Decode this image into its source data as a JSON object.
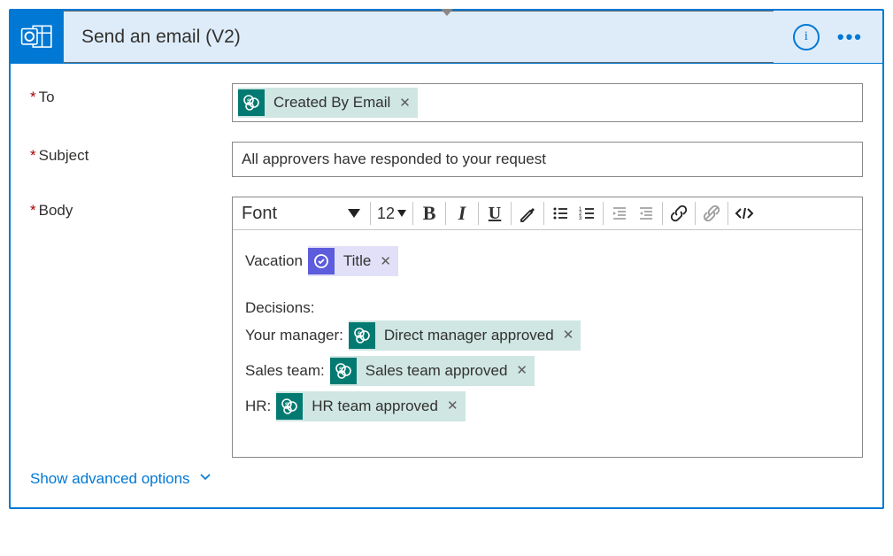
{
  "header": {
    "title": "Send an email (V2)",
    "info_label": "i",
    "menu_label": "•••"
  },
  "fields": {
    "to": {
      "label": "To",
      "required": true,
      "token": "Created By Email"
    },
    "subject": {
      "label": "Subject",
      "required": true,
      "value": "All approvers have responded to your request"
    },
    "body": {
      "label": "Body",
      "required": true
    }
  },
  "toolbar": {
    "font": "Font",
    "size": "12",
    "bold": "B",
    "italic": "I",
    "underline": "U"
  },
  "body_content": {
    "line1_pre": "Vacation",
    "line1_token": "Title",
    "line2": "Decisions:",
    "line3_pre": "Your manager:",
    "line3_token": "Direct manager approved",
    "line4_pre": "Sales team:",
    "line4_token": "Sales team approved",
    "line5_pre": "HR:",
    "line5_token": "HR team approved"
  },
  "footer": {
    "advanced_label": "Show advanced options"
  }
}
